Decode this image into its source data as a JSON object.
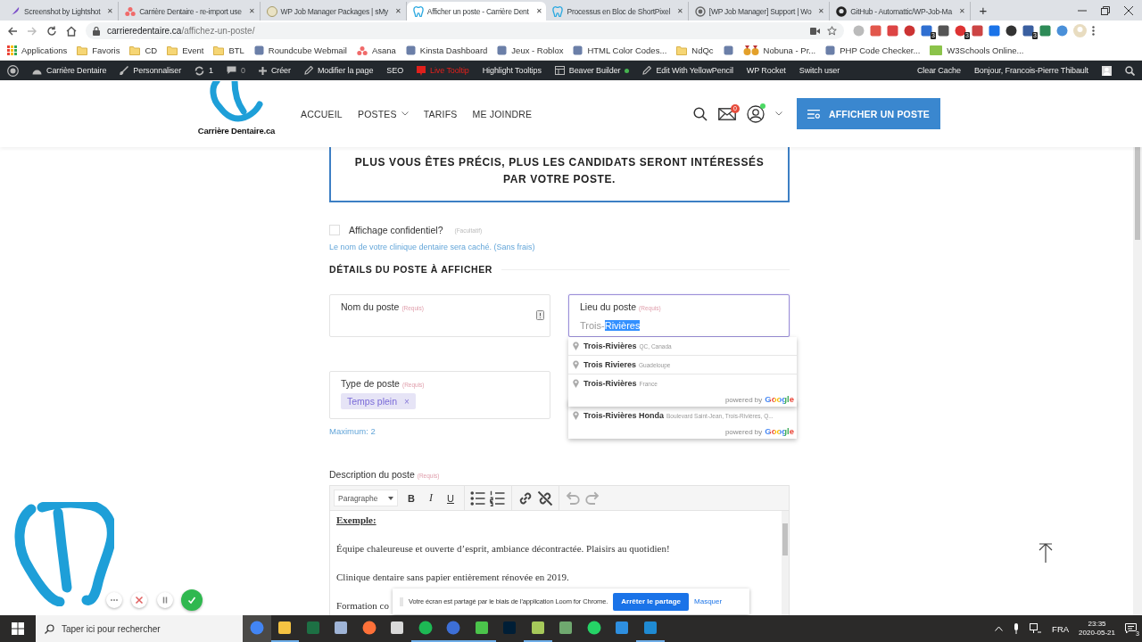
{
  "browser": {
    "tabs": [
      {
        "title": "Screenshot by Lightshot",
        "kind": "feather",
        "selected": false,
        "close": "✕"
      },
      {
        "title": "Carrière Dentaire - re-import use",
        "kind": "dots",
        "selected": false,
        "close": "✕"
      },
      {
        "title": "WP Job Manager Packages | sMy",
        "kind": "coin",
        "selected": false,
        "close": "✕"
      },
      {
        "title": "Afficher un poste - Carrière Dent",
        "kind": "tooth",
        "selected": true,
        "close": "✕"
      },
      {
        "title": "Processus en Bloc de ShortPixel",
        "kind": "tooth",
        "selected": false,
        "close": "✕"
      },
      {
        "title": "[WP Job Manager] Support | Wo",
        "kind": "wordpress",
        "selected": false,
        "close": "✕"
      },
      {
        "title": "GitHub - Automattic/WP-Job-Ma",
        "kind": "github",
        "selected": false,
        "close": "✕"
      }
    ],
    "new_tab": "+",
    "address": {
      "host": "carrieredentaire.ca",
      "path": "/affichez-un-poste/"
    },
    "extensions": [
      {
        "kind": "plain"
      },
      {
        "kind": "plain"
      },
      {
        "kind": "plain"
      },
      {
        "kind": "plain"
      },
      {
        "kind": "badge",
        "badge": "3"
      },
      {
        "kind": "plain"
      },
      {
        "kind": "badge",
        "badge": "3"
      },
      {
        "kind": "plain"
      },
      {
        "kind": "plain"
      },
      {
        "kind": "plain"
      },
      {
        "kind": "badge",
        "badge": "3"
      },
      {
        "kind": "plain"
      },
      {
        "kind": "plain"
      }
    ],
    "bookmarks": [
      {
        "label": "Applications",
        "kind": "apps"
      },
      {
        "label": "Favoris",
        "kind": "folder"
      },
      {
        "label": "CD",
        "kind": "folder"
      },
      {
        "label": "Event",
        "kind": "folder"
      },
      {
        "label": "BTL",
        "kind": "folder"
      },
      {
        "label": "Roundcube Webmail",
        "kind": "site"
      },
      {
        "label": "Asana",
        "kind": "dots"
      },
      {
        "label": "Kinsta Dashboard",
        "kind": "site"
      },
      {
        "label": "Jeux - Roblox",
        "kind": "site"
      },
      {
        "label": "HTML Color Codes...",
        "kind": "site"
      },
      {
        "label": "NdQc",
        "kind": "folder"
      },
      {
        "kind": "site"
      },
      {
        "label": "Nobuna - Pr...",
        "kind": "medal"
      },
      {
        "label": "PHP Code Checker...",
        "kind": "site"
      },
      {
        "label": "W3Schools Online...",
        "kind": "green"
      }
    ]
  },
  "admin_bar": {
    "items": [
      {
        "kind": "wordpress"
      },
      {
        "label": "Carrière Dentaire",
        "kind": "dashboard"
      },
      {
        "label": "Personnaliser",
        "kind": "brush"
      },
      {
        "label": "1",
        "kind": "updates"
      },
      {
        "label": "0",
        "kind": "comments"
      },
      {
        "label": "Créer",
        "kind": "plus"
      },
      {
        "label": "Modifier la page",
        "kind": "pencil"
      },
      {
        "label": "SEO",
        "kind": "text"
      },
      {
        "label": "Live Tooltip",
        "kind": "alert",
        "color": "#e0201c"
      },
      {
        "label": "Highlight Tooltips",
        "kind": "text"
      },
      {
        "label": "Beaver Builder",
        "kind": "builder",
        "status_dot": {
          "color": "#46b450"
        }
      },
      {
        "label": "Edit With YellowPencil",
        "kind": "pencil"
      },
      {
        "label": "WP Rocket",
        "kind": "text"
      },
      {
        "label": "Switch user",
        "kind": "text"
      }
    ],
    "clear_cache": "Clear Cache",
    "greeting": "Bonjour, Francois-Pierre Thibault"
  },
  "site_header": {
    "logo_text": "Carrière Dentaire.ca",
    "nav": [
      {
        "label": "ACCUEIL",
        "dropdown": false
      },
      {
        "label": "POSTES",
        "dropdown": true
      },
      {
        "label": "TARIFS",
        "dropdown": false
      },
      {
        "label": "ME JOINDRE",
        "dropdown": false
      }
    ],
    "mail_badge": "0",
    "cta": "AFFICHER UN POSTE"
  },
  "form": {
    "notice": "PLUS VOUS ÊTES PRÉCIS, PLUS LES CANDIDATS SERONT INTÉRESSÉS PAR VOTRE POSTE.",
    "confidential": {
      "label": "Affichage confidentiel?",
      "tag": "(Facultatif)",
      "checked": false,
      "hint": "Le nom de votre clinique dentaire sera caché. (Sans frais)"
    },
    "section_title": "DÉTAILS DU POSTE À AFFICHER",
    "fields": [
      {
        "kind": "text",
        "label": "Nom du poste",
        "tag": "(Requis)",
        "focused": false
      },
      {
        "kind": "location",
        "label": "Lieu du poste",
        "tag": "(Requis)",
        "focused": true,
        "value": "Trois-",
        "selected_value": "Rivières"
      },
      {
        "kind": "tags",
        "label": "Type de poste",
        "tag": "(Requis)",
        "focused": false,
        "chips": [
          {
            "label": "Temps plein",
            "remove": "×"
          }
        ],
        "hint": "Maximum: 2"
      }
    ],
    "autocomplete_panels": [
      {
        "items": [
          {
            "main": "Trois-Rivières",
            "secondary": "QC, Canada"
          },
          {
            "main": "Trois Rivieres",
            "secondary": "Guadeloupe"
          },
          {
            "main": "Trois-Rivières",
            "secondary": "France"
          }
        ],
        "powered_by": "powered by",
        "brand": "Google"
      },
      {
        "items": [
          {
            "main": "Trois-Rivières Honda",
            "secondary": "Boulevard Saint-Jean, Trois-Rivières, Q..."
          }
        ],
        "powered_by": "powered by",
        "brand": "Google"
      }
    ],
    "description": {
      "label": "Description du poste",
      "tag": "(Requis)",
      "format": "Paragraphe",
      "tool_groups": [
        [
          {
            "kind": "bold",
            "label": "B",
            "disabled": false
          },
          {
            "kind": "italic",
            "label": "I",
            "disabled": false
          },
          {
            "kind": "underline",
            "label": "U",
            "disabled": false
          }
        ],
        [
          {
            "kind": "bullets",
            "disabled": false
          },
          {
            "kind": "numbers",
            "disabled": false
          }
        ],
        [
          {
            "kind": "link",
            "disabled": false
          },
          {
            "kind": "unlink",
            "disabled": false
          }
        ],
        [
          {
            "kind": "undo",
            "disabled": true
          },
          {
            "kind": "redo",
            "disabled": true
          }
        ]
      ],
      "content": [
        {
          "kind": "heading",
          "text": "Exemple:"
        },
        {
          "kind": "paragraph",
          "text": "Équipe chaleureuse et ouverte d’esprit, ambiance décontractée. Plaisirs au quotidien!"
        },
        {
          "kind": "paragraph",
          "text": "Clinique dentaire sans papier entièrement rénovée en 2019."
        },
        {
          "kind": "paragraph",
          "text": "Formation co"
        }
      ]
    }
  },
  "loom": {
    "message": "Votre écran est partagé par le biais de l'application Loom for Chrome.",
    "stop": "Arrêter le partage",
    "hide": "Masquer"
  },
  "taskbar": {
    "search_placeholder": "Taper ici pour rechercher",
    "apps": [
      {
        "running": false,
        "active": true
      },
      {
        "running": true,
        "active": false
      },
      {
        "running": false,
        "active": false
      },
      {
        "running": false,
        "active": false
      },
      {
        "running": false,
        "active": false
      },
      {
        "running": false,
        "active": false
      },
      {
        "running": true,
        "active": false
      },
      {
        "running": true,
        "active": false
      },
      {
        "running": true,
        "active": false
      },
      {
        "running": false,
        "active": false
      },
      {
        "running": true,
        "active": false
      },
      {
        "running": false,
        "active": false
      },
      {
        "running": false,
        "active": false
      },
      {
        "running": false,
        "active": false
      },
      {
        "running": true,
        "active": false
      }
    ],
    "language": "FRA",
    "time": "23:35",
    "date": "2020-05-21",
    "notifications": "3"
  }
}
